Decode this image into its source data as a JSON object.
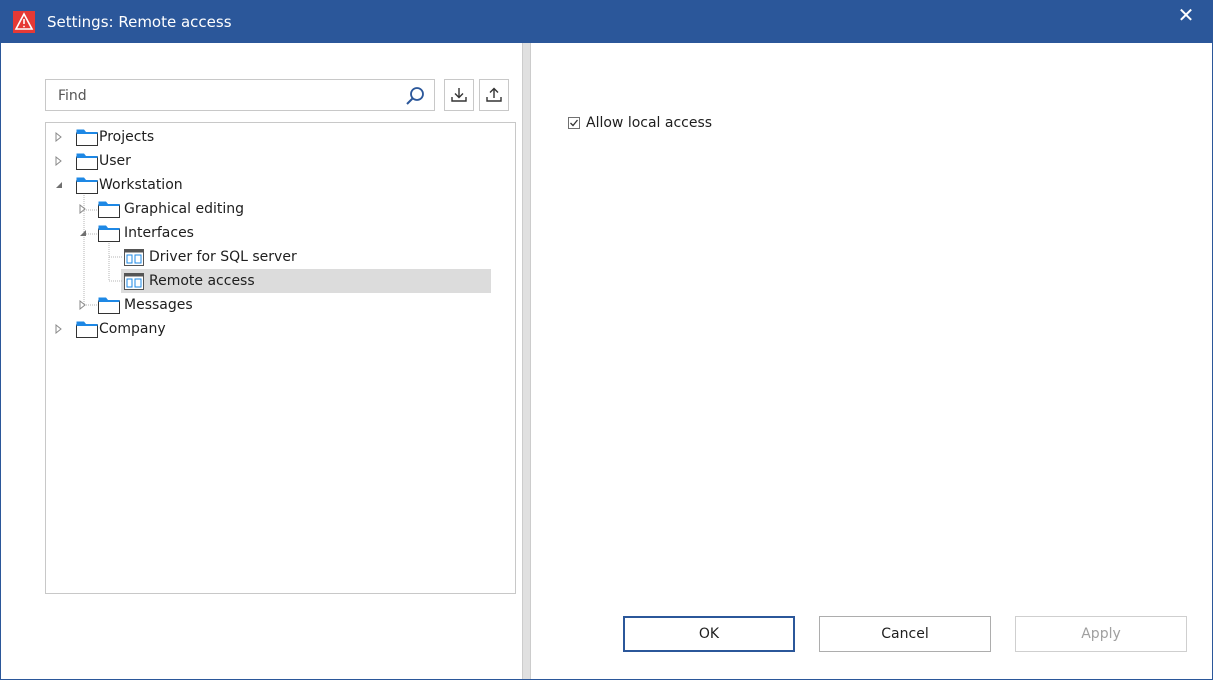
{
  "window": {
    "title": "Settings: Remote access",
    "close_label": "✕"
  },
  "search": {
    "placeholder": "Find"
  },
  "tree": {
    "items": [
      {
        "label": "Projects"
      },
      {
        "label": "User"
      },
      {
        "label": "Workstation"
      },
      {
        "label": "Graphical editing"
      },
      {
        "label": "Interfaces"
      },
      {
        "label": "Driver for SQL server"
      },
      {
        "label": "Remote access"
      },
      {
        "label": "Messages"
      },
      {
        "label": "Company"
      }
    ],
    "selected": "Remote access"
  },
  "options": {
    "allow_local_access": {
      "label": "Allow local access",
      "checked": true
    }
  },
  "buttons": {
    "ok": "OK",
    "cancel": "Cancel",
    "apply": "Apply"
  },
  "colors": {
    "titlebar": "#2b579a",
    "folder": "#1e88e5",
    "selection": "#dcdcdc",
    "logo": "#e53935"
  },
  "icons": [
    "warning-logo-icon",
    "close-icon",
    "search-icon",
    "import-icon",
    "export-icon",
    "folder-icon",
    "settings-page-icon",
    "expand-arrow-icon",
    "collapse-arrow-icon"
  ]
}
